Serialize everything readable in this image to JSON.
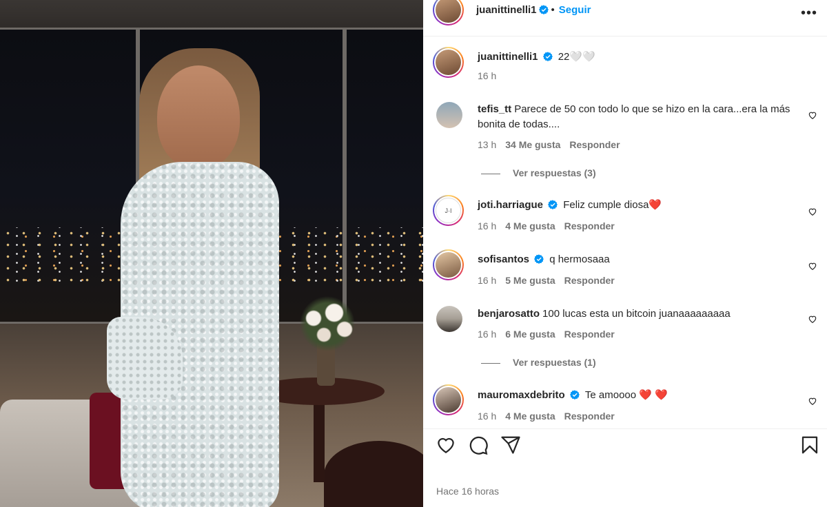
{
  "post": {
    "author": "juanittinelli1",
    "follow_label": "Seguir",
    "dot": "•",
    "more_label": "•••",
    "caption": "22🤍🤍",
    "caption_time": "16 h",
    "posted_ago": "Hace 16 horas"
  },
  "comments": [
    {
      "user": "tefis_tt",
      "text": "Parece de 50 con todo lo que se hizo en la cara...era la más bonita de todas....",
      "time": "13 h",
      "likes": "34 Me gusta",
      "reply": "Responder",
      "verified": false
    },
    {
      "user": "joti.harriague",
      "text": "Feliz cumple diosa❤️",
      "time": "16 h",
      "likes": "4 Me gusta",
      "reply": "Responder",
      "verified": true,
      "avatar_text": "J·I"
    },
    {
      "user": "sofisantos",
      "text": "q hermosaaa",
      "time": "16 h",
      "likes": "5 Me gusta",
      "reply": "Responder",
      "verified": true
    },
    {
      "user": "benjarosatto",
      "text": "100 lucas esta un bitcoin juanaaaaaaaaa",
      "time": "16 h",
      "likes": "6 Me gusta",
      "reply": "Responder",
      "verified": false
    },
    {
      "user": "mauromaxdebrito",
      "text": "Te amoooo ❤️ ❤️",
      "time": "16 h",
      "likes": "4 Me gusta",
      "reply": "Responder",
      "verified": true
    }
  ],
  "replies": [
    {
      "label": "Ver respuestas (3)"
    },
    {
      "label": "Ver respuestas (1)"
    }
  ],
  "colors": {
    "link": "#0095f6",
    "muted": "#737373",
    "verified": "#0095f6"
  },
  "icons": [
    "heart-icon",
    "comment-icon",
    "share-icon",
    "bookmark-icon",
    "verified-icon",
    "more-icon"
  ]
}
